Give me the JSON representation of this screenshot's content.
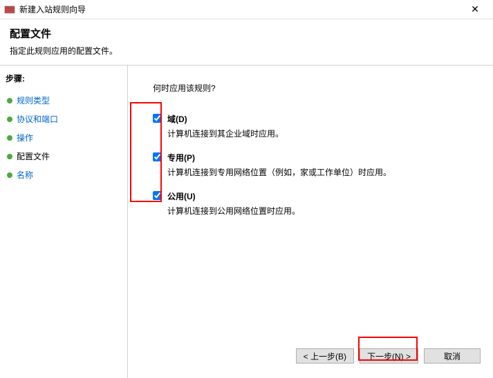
{
  "window": {
    "title": "新建入站规则向导",
    "close_symbol": "✕"
  },
  "header": {
    "title": "配置文件",
    "subtitle": "指定此规则应用的配置文件。"
  },
  "sidebar": {
    "steps_label": "步骤:",
    "items": [
      {
        "label": "规则类型"
      },
      {
        "label": "协议和端口"
      },
      {
        "label": "操作"
      },
      {
        "label": "配置文件"
      },
      {
        "label": "名称"
      }
    ],
    "current_index": 3
  },
  "main": {
    "prompt": "何时应用该规则?",
    "checkboxes": [
      {
        "label": "域(D)",
        "desc": "计算机连接到其企业域时应用。",
        "checked": true
      },
      {
        "label": "专用(P)",
        "desc": "计算机连接到专用网络位置（例如，家或工作单位）时应用。",
        "checked": true
      },
      {
        "label": "公用(U)",
        "desc": "计算机连接到公用网络位置时应用。",
        "checked": true
      }
    ]
  },
  "buttons": {
    "back": "< 上一步(B)",
    "next": "下一步(N) >",
    "cancel": "取消"
  }
}
